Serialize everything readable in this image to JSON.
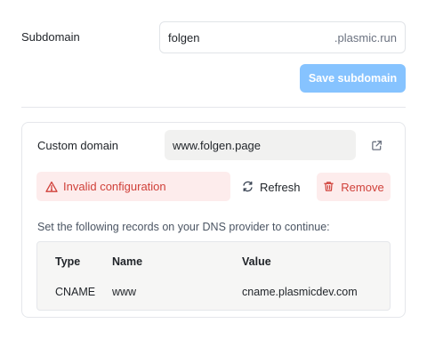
{
  "subdomain": {
    "label": "Subdomain",
    "value": "folgen",
    "suffix": ".plasmic.run",
    "save_label": "Save subdomain"
  },
  "custom_domain": {
    "label": "Custom domain",
    "value": "www.folgen.page",
    "status_text": "Invalid configuration",
    "refresh_label": "Refresh",
    "remove_label": "Remove",
    "instructions": "Set the following records on your DNS provider to continue:",
    "records": {
      "headers": [
        "Type",
        "Name",
        "Value"
      ],
      "rows": [
        [
          "CNAME",
          "www",
          "cname.plasmicdev.com"
        ]
      ]
    }
  },
  "colors": {
    "save_button_bg": "#86c3ff",
    "error_text": "#d0413a",
    "error_bg": "#fdecec"
  },
  "icons": {
    "warning": "warning-triangle-icon",
    "refresh": "refresh-icon",
    "remove": "trash-icon",
    "external": "external-link-icon"
  }
}
